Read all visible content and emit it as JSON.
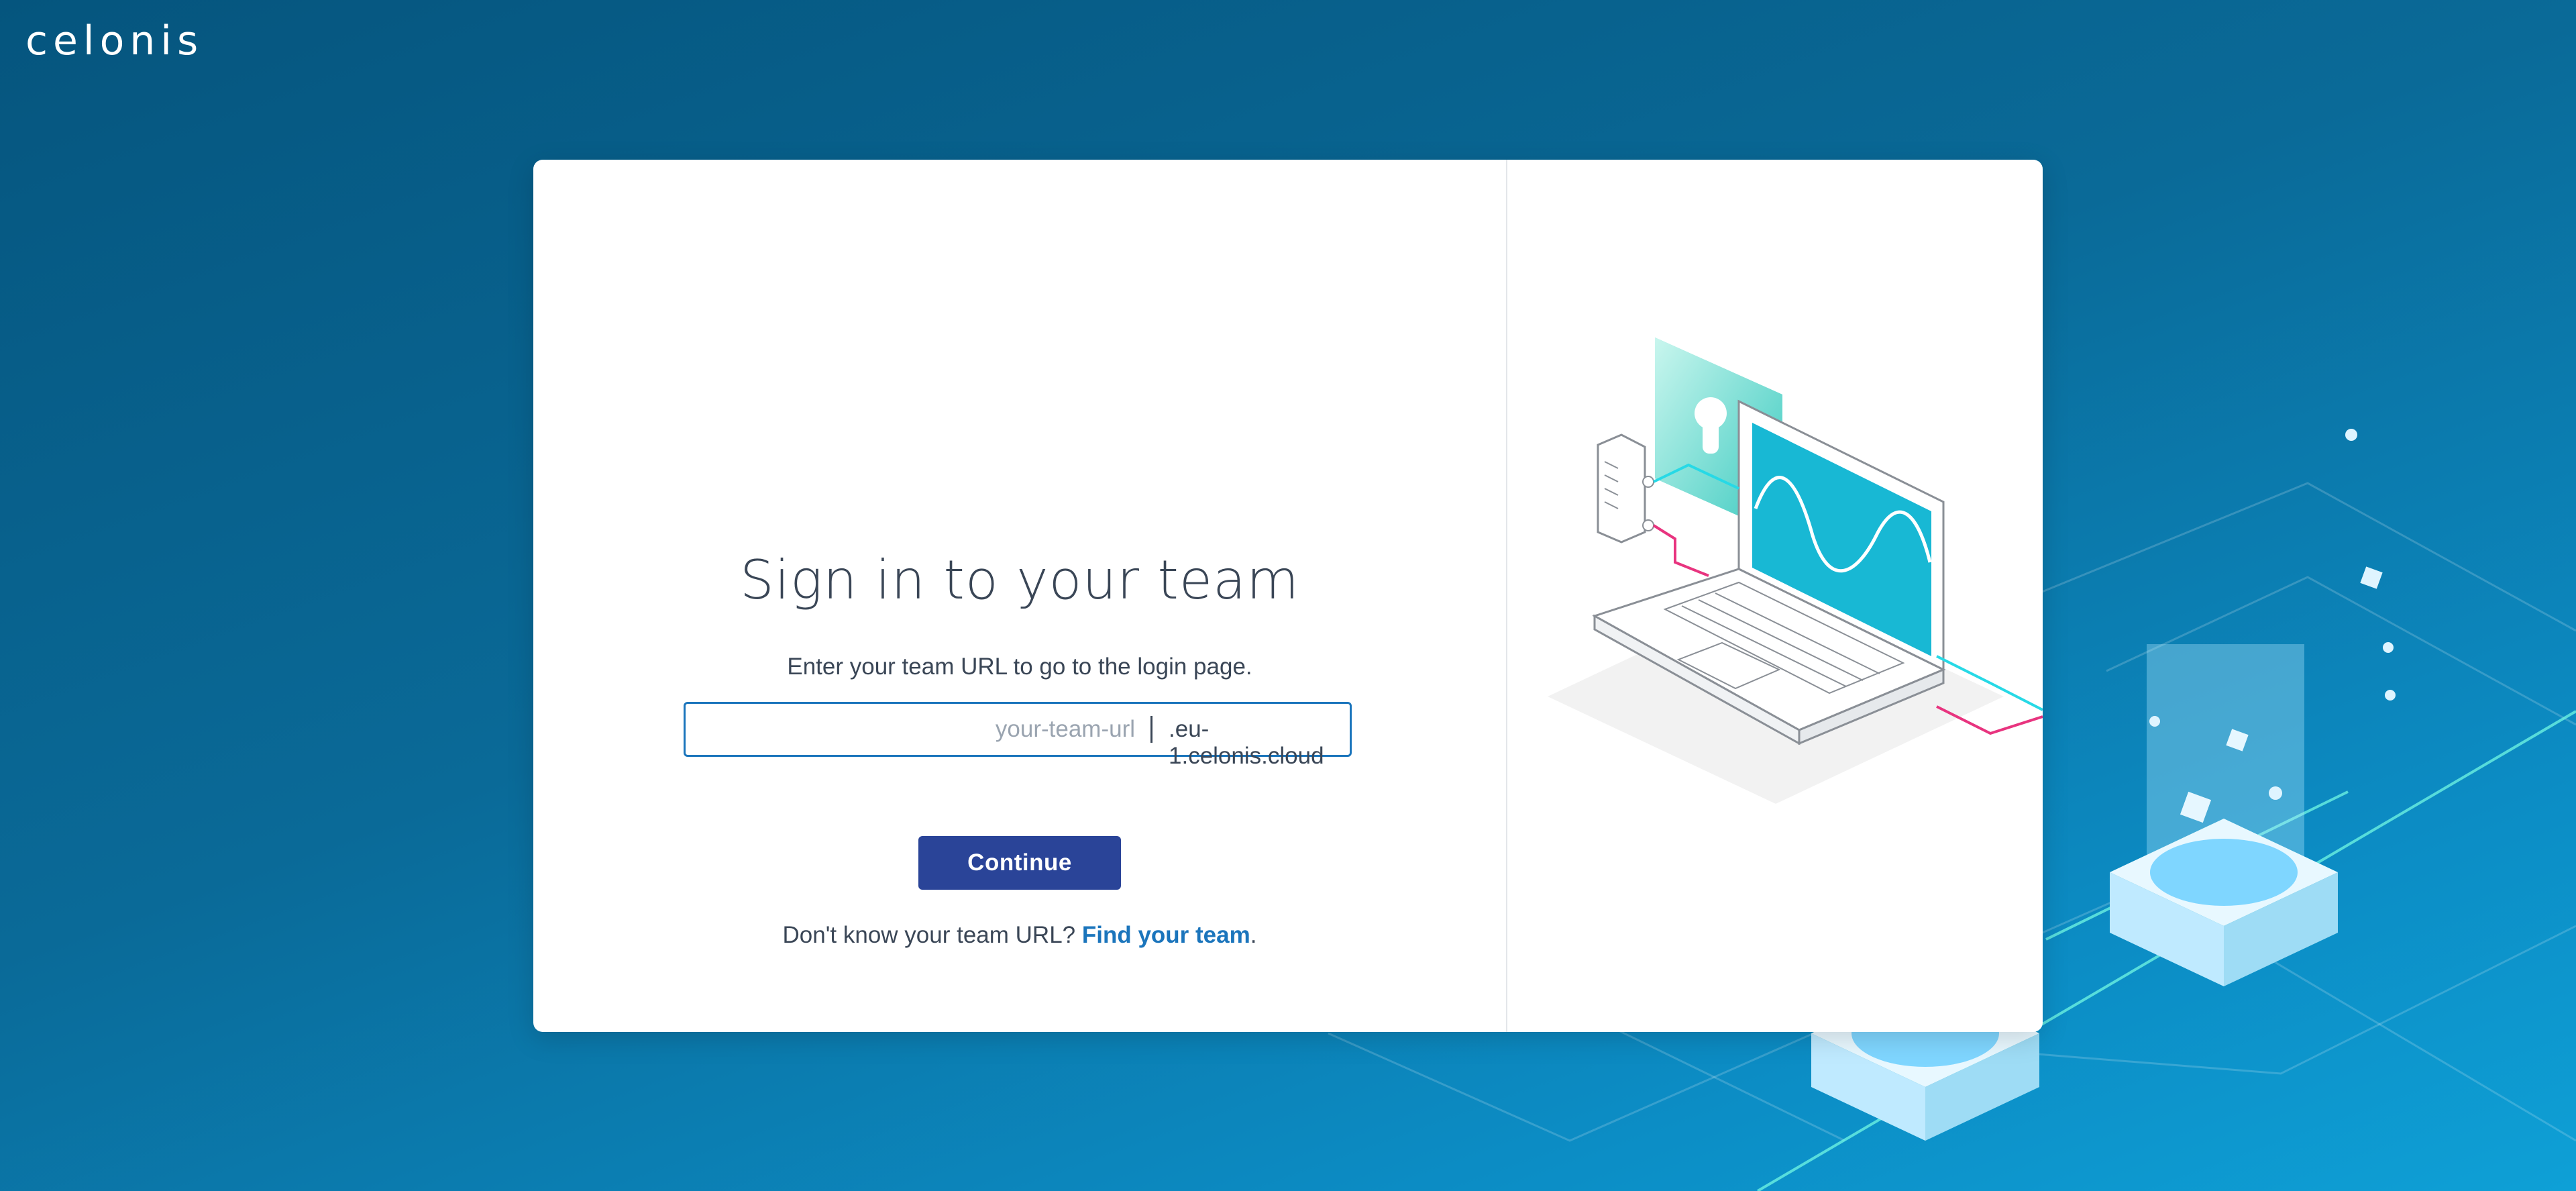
{
  "brand": {
    "logo_text": "celonis",
    "primary_color": "#2a4498",
    "link_color": "#1b75bc"
  },
  "login": {
    "title": "Sign in to your team",
    "subtitle": "Enter your team URL to go to the login page.",
    "url_input": {
      "value": "",
      "placeholder": "your-team-url",
      "suffix": ".eu-1.celonis.cloud"
    },
    "continue_label": "Continue",
    "help_prefix": "Don't know your team URL? ",
    "help_link_label": "Find your team",
    "help_suffix": "."
  },
  "icons": {
    "illustration": "laptop-security-illustration",
    "background": "isometric-cloud-servers-decoration"
  }
}
